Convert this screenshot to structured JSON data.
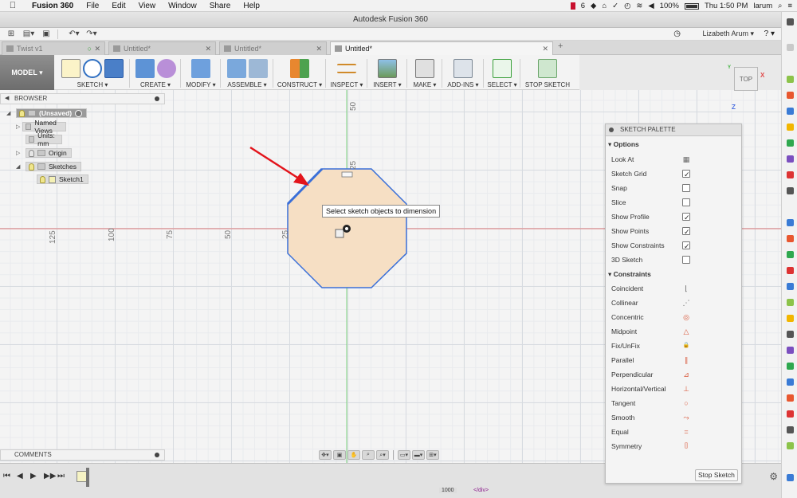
{
  "menubar": {
    "app_name": "Fusion 360",
    "items": [
      "File",
      "Edit",
      "View",
      "Window",
      "Share",
      "Help"
    ],
    "tray_number": "6",
    "battery": "100%",
    "clock": "Thu 1:50 PM",
    "user": "larum"
  },
  "window": {
    "title": "Autodesk Fusion 360"
  },
  "appbar": {
    "user_name": "Lizabeth Arum ▾",
    "help": "? ▾"
  },
  "tabs": [
    {
      "label": "Twist v1",
      "active": false
    },
    {
      "label": "Untitled*",
      "active": false
    },
    {
      "label": "Untitled*",
      "active": false
    },
    {
      "label": "Untitled*",
      "active": true
    }
  ],
  "toolbar": {
    "workspace": "MODEL ▾",
    "groups": [
      {
        "label": "SKETCH ▾",
        "icon": "sketch-icon"
      },
      {
        "label": "CREATE ▾",
        "icon": "create-icon"
      },
      {
        "label": "MODIFY ▾",
        "icon": "modify-icon"
      },
      {
        "label": "ASSEMBLE ▾",
        "icon": "assemble-icon"
      },
      {
        "label": "CONSTRUCT ▾",
        "icon": "construct-icon"
      },
      {
        "label": "INSPECT ▾",
        "icon": "inspect-icon"
      },
      {
        "label": "INSERT ▾",
        "icon": "insert-icon"
      },
      {
        "label": "MAKE ▾",
        "icon": "make-icon"
      },
      {
        "label": "ADD-INS ▾",
        "icon": "addins-icon"
      },
      {
        "label": "SELECT ▾",
        "icon": "select-icon"
      },
      {
        "label": "STOP SKETCH",
        "icon": "stop-sketch-icon"
      }
    ]
  },
  "browser": {
    "title": "BROWSER",
    "root": "(Unsaved)",
    "nodes": [
      {
        "label": "Named Views"
      },
      {
        "label": "Units: mm"
      },
      {
        "label": "Origin"
      },
      {
        "label": "Sketches"
      },
      {
        "label": "Sketch1"
      }
    ]
  },
  "comments": {
    "title": "COMMENTS"
  },
  "canvas": {
    "tooltip": "Select sketch objects to dimension",
    "axis_labels_h": [
      "125",
      "100",
      "75",
      "50",
      "25"
    ],
    "axis_labels_v": [
      "50",
      "25"
    ],
    "profile_fill": "#f6dfc4",
    "line_color": "#3a6fd8",
    "arrow_color": "#e3141b"
  },
  "viewcube": {
    "face": "TOP",
    "x": "X",
    "z": "Z",
    "y": "Y"
  },
  "palette": {
    "title": "SKETCH PALETTE",
    "options_header": "Options",
    "options": [
      {
        "label": "Look At",
        "type": "icon",
        "icon": "look-at-icon"
      },
      {
        "label": "Sketch Grid",
        "type": "check",
        "checked": true
      },
      {
        "label": "Snap",
        "type": "check",
        "checked": false
      },
      {
        "label": "Slice",
        "type": "check",
        "checked": false
      },
      {
        "label": "Show Profile",
        "type": "check",
        "checked": true
      },
      {
        "label": "Show Points",
        "type": "check",
        "checked": true
      },
      {
        "label": "Show Constraints",
        "type": "check",
        "checked": true
      },
      {
        "label": "3D Sketch",
        "type": "check",
        "checked": false
      }
    ],
    "constraints_header": "Constraints",
    "constraints": [
      {
        "label": "Coincident",
        "glyph": "⌊"
      },
      {
        "label": "Collinear",
        "glyph": "⋰"
      },
      {
        "label": "Concentric",
        "glyph": "◎"
      },
      {
        "label": "Midpoint",
        "glyph": "△"
      },
      {
        "label": "Fix/UnFix",
        "glyph": "🔒"
      },
      {
        "label": "Parallel",
        "glyph": "∥"
      },
      {
        "label": "Perpendicular",
        "glyph": "⊿"
      },
      {
        "label": "Horizontal/Vertical",
        "glyph": "⊥"
      },
      {
        "label": "Tangent",
        "glyph": "○"
      },
      {
        "label": "Smooth",
        "glyph": "⤳"
      },
      {
        "label": "Equal",
        "glyph": "="
      },
      {
        "label": "Symmetry",
        "glyph": "[]"
      }
    ],
    "stop_button": "Stop Sketch"
  },
  "statusbar": {
    "code_a": "1000",
    "code_b": "</div>"
  }
}
